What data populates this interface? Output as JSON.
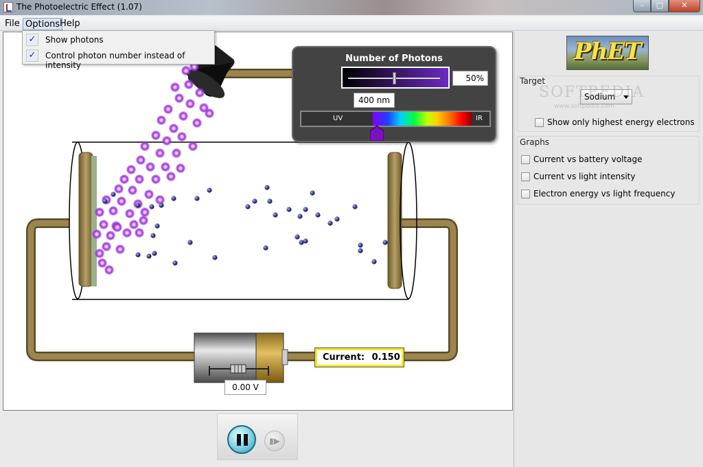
{
  "window": {
    "title": "The Photoelectric Effect (1.07)",
    "min": "–",
    "max": "□",
    "close": "✕"
  },
  "menubar": {
    "file": "File",
    "options": "Options",
    "help": "Help"
  },
  "options_menu": [
    {
      "label": "Show photons",
      "checked": true
    },
    {
      "label": "Control photon number instead of intensity",
      "checked": true
    }
  ],
  "photon_control": {
    "title": "Number of Photons",
    "intensity_label": "50%",
    "intensity_fraction": 0.5,
    "wavelength_label": "400 nm",
    "wavelength_nm": 400,
    "uv_label": "UV",
    "ir_label": "IR"
  },
  "current": {
    "label": "Current:",
    "value": "0.150"
  },
  "battery": {
    "voltage_label": "0.00 V"
  },
  "clock": {
    "pause_icon": "pause-icon",
    "step_icon": "step-icon"
  },
  "right_panel": {
    "logo": "PhET",
    "target_title": "Target",
    "target_value": "Sodium",
    "highest_energy_label": "Show only highest energy electrons",
    "graphs_title": "Graphs",
    "graphs": [
      {
        "label": "Current vs battery voltage",
        "checked": false
      },
      {
        "label": "Current vs light intensity",
        "checked": false
      },
      {
        "label": "Electron energy vs light frequency",
        "checked": false
      }
    ],
    "watermark": "SOFTPEDIA",
    "watermark_url": "www.softpedia.com"
  },
  "colors": {
    "photon": "#9a30d8",
    "electron": "#3a3f8f",
    "wire": "#8f7a4a",
    "current_border": "#f4e820"
  }
}
